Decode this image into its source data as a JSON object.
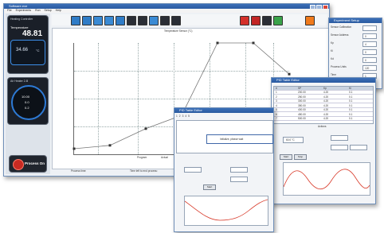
{
  "main_window": {
    "title": "Software.exe",
    "menu": [
      "File",
      "Experiments",
      "Run",
      "Setup",
      "Help"
    ],
    "temp_panel": {
      "heading": "Heating Controller",
      "label": "Temperature",
      "big_value": "48.81",
      "small_value": "34.66",
      "unit": "°C"
    },
    "gauge_panel": {
      "heading": "Air Heater 2-B",
      "lines": [
        "10.00",
        "0.0",
        "0.2"
      ]
    },
    "process_button": "Process On",
    "chart_title": "Temperature Sensor (°C)",
    "bottom_left": "Process time:",
    "bottom_right": "Time left to end process:",
    "legend": [
      "Program",
      "Actual"
    ]
  },
  "chart_data": {
    "type": "line",
    "x": [
      0,
      1,
      2,
      3,
      4,
      5,
      6
    ],
    "series": [
      {
        "values": [
          5,
          8,
          23,
          35,
          100,
          100,
          72
        ]
      }
    ],
    "ylim": [
      0,
      100
    ]
  },
  "settings_window": {
    "title": "Experiment Setup",
    "rows": [
      {
        "label": "Sensor Calibration",
        "value": ""
      },
      {
        "label": "Sensor Address",
        "value": "0"
      },
      {
        "label": "Kp",
        "value": "4"
      },
      {
        "label": "Ki",
        "value": "0"
      },
      {
        "label": "Kd",
        "value": "0"
      },
      {
        "label": "Process Units",
        "value": "120"
      },
      {
        "label": "Time",
        "value": "1"
      }
    ]
  },
  "pid_window_left": {
    "title": "PID Table Editor",
    "popup": "Initialize, please wait",
    "apply_button": "Start",
    "tabs": [
      "1",
      "2",
      "3",
      "4",
      "5"
    ]
  },
  "pid_window_right": {
    "title": "PID Table Editor",
    "headers": [
      "#",
      "SP",
      "Kp",
      "Ki"
    ],
    "rows": [
      [
        "1",
        "200.00",
        "4.20",
        "0.1"
      ],
      [
        "2",
        "250.00",
        "4.20",
        "0.1"
      ],
      [
        "3",
        "300.00",
        "4.20",
        "0.1"
      ],
      [
        "4",
        "350.00",
        "4.20",
        "0.1"
      ],
      [
        "5",
        "400.00",
        "4.20",
        "0.1"
      ],
      [
        "6",
        "450.00",
        "4.20",
        "0.1"
      ],
      [
        "7",
        "500.00",
        "4.20",
        "0.1"
      ]
    ],
    "section": "Actions",
    "value_box": "60.0 °C",
    "start_button": "Start",
    "stop_button": "Stop"
  }
}
